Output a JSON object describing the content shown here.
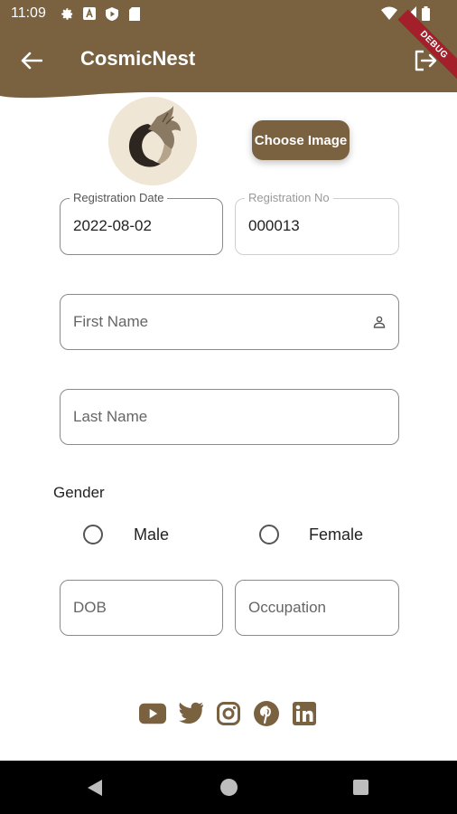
{
  "status_bar": {
    "time": "11:09",
    "icons_left": [
      "gear-icon",
      "a-icon",
      "shield-play-icon",
      "sd-card-icon"
    ],
    "icons_right": [
      "wifi-icon",
      "signal-icon",
      "battery-icon"
    ]
  },
  "app_bar": {
    "title": "CosmicNest",
    "back_icon": "arrow-left-icon",
    "logout_icon": "logout-icon",
    "debug_banner": "DEBUG"
  },
  "avatar": {
    "icon": "horse-logo-icon"
  },
  "choose_image_label": "Choose Image",
  "registration_date": {
    "label": "Registration Date",
    "value": "2022-08-02"
  },
  "registration_no": {
    "label": "Registration No",
    "value": "000013"
  },
  "first_name": {
    "placeholder": "First Name",
    "icon": "person-icon"
  },
  "last_name": {
    "placeholder": "Last Name"
  },
  "gender": {
    "label": "Gender",
    "options": [
      {
        "label": "Male",
        "selected": false
      },
      {
        "label": "Female",
        "selected": false
      }
    ]
  },
  "dob": {
    "placeholder": "DOB"
  },
  "occupation": {
    "placeholder": "Occupation"
  },
  "social_icons": [
    "youtube-icon",
    "twitter-icon",
    "instagram-icon",
    "pinterest-icon",
    "linkedin-icon"
  ],
  "colors": {
    "brand": "#7a6140",
    "debug": "#a31f2a",
    "nav": "#000000"
  }
}
